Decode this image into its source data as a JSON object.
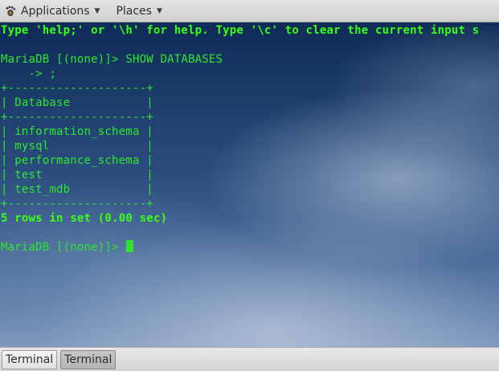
{
  "top_panel": {
    "applications_label": "Applications",
    "places_label": "Places"
  },
  "terminal": {
    "lines": [
      {
        "text": "Type 'help;' or '\\h' for help. Type '\\c' to clear the current input s",
        "bold": true
      },
      {
        "text": "",
        "bold": false
      },
      {
        "text": "MariaDB [(none)]> SHOW DATABASES",
        "bold": false
      },
      {
        "text": "    -> ;",
        "bold": false
      },
      {
        "text": "+--------------------+",
        "bold": false
      },
      {
        "text": "| Database           |",
        "bold": false
      },
      {
        "text": "+--------------------+",
        "bold": false
      },
      {
        "text": "| information_schema |",
        "bold": false
      },
      {
        "text": "| mysql              |",
        "bold": false
      },
      {
        "text": "| performance_schema |",
        "bold": false
      },
      {
        "text": "| test               |",
        "bold": false
      },
      {
        "text": "| test_mdb           |",
        "bold": false
      },
      {
        "text": "+--------------------+",
        "bold": false
      },
      {
        "text": "5 rows in set (0.00 sec)",
        "bold": true
      },
      {
        "text": "",
        "bold": false
      }
    ],
    "prompt": "MariaDB [(none)]> ",
    "text_color": "#2ee52e"
  },
  "taskbar": {
    "tasks": [
      {
        "label": "Terminal",
        "active": false
      },
      {
        "label": "Terminal",
        "active": true
      }
    ]
  }
}
